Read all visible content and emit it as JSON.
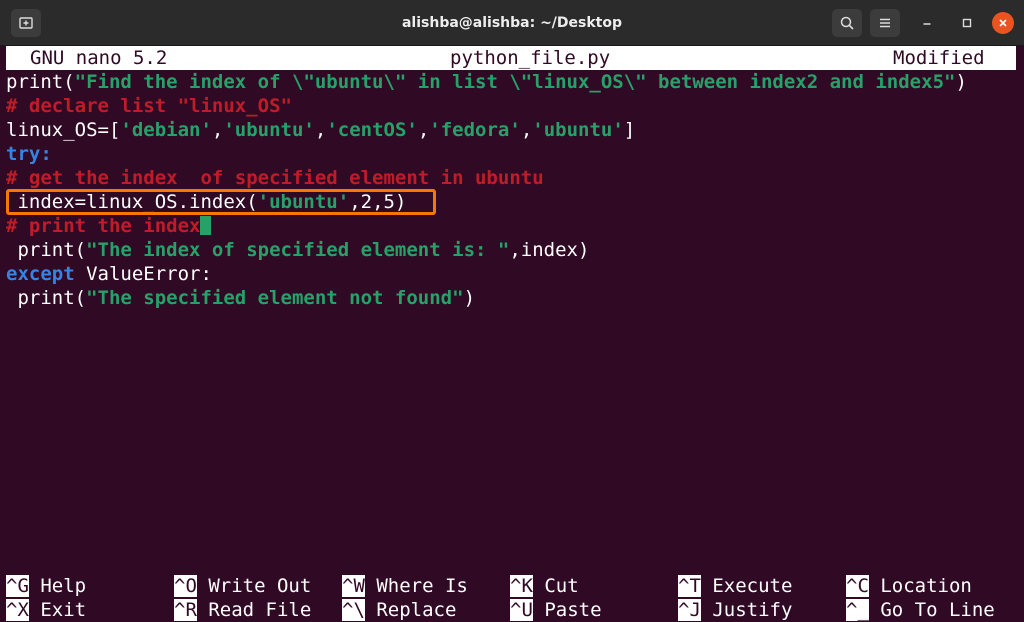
{
  "window": {
    "title": "alishba@alishba: ~/Desktop"
  },
  "nano": {
    "version": "GNU nano 5.2",
    "filename": "python_file.py",
    "status": "Modified"
  },
  "code": {
    "l1_a": "print(",
    "l1_b": "\"Find the index of \\\"ubuntu\\\" in list \\\"linux_OS\\\" between index2 and index5\"",
    "l1_c": ")",
    "l2": "# declare list \"linux_OS\"",
    "l3_a": "linux_OS=[",
    "l3_s1": "'debian'",
    "l3_c1": ",",
    "l3_s2": "'ubuntu'",
    "l3_c2": ",",
    "l3_s3": "'centOS'",
    "l3_c3": ",",
    "l3_s4": "'fedora'",
    "l3_c4": ",",
    "l3_s5": "'ubuntu'",
    "l3_b": "]",
    "l4": "try:",
    "l5": "# get the index  of specified element in ubuntu",
    "l6_a": " index=linux_OS.index(",
    "l6_s": "'ubuntu'",
    "l6_b": ",2,5)",
    "l7": "# print the index",
    "l8_a": " print(",
    "l8_s": "\"The index of specified element is: \"",
    "l8_b": ",index)",
    "l9_kw": "except",
    "l9_b": " ValueError:",
    "l10_a": " print(",
    "l10_s": "\"The specified element not found\"",
    "l10_b": ")"
  },
  "shortcuts": [
    {
      "key": "^G",
      "label": "Help"
    },
    {
      "key": "^O",
      "label": "Write Out"
    },
    {
      "key": "^W",
      "label": "Where Is"
    },
    {
      "key": "^K",
      "label": "Cut"
    },
    {
      "key": "^T",
      "label": "Execute"
    },
    {
      "key": "^C",
      "label": "Location"
    },
    {
      "key": "^X",
      "label": "Exit"
    },
    {
      "key": "^R",
      "label": "Read File"
    },
    {
      "key": "^\\",
      "label": "Replace"
    },
    {
      "key": "^U",
      "label": "Paste"
    },
    {
      "key": "^J",
      "label": "Justify"
    },
    {
      "key": "^_",
      "label": "Go To Line"
    }
  ],
  "icons": {
    "new_tab": "new-tab-icon",
    "search": "search-icon",
    "menu": "hamburger-menu-icon",
    "minimize": "minimize-icon",
    "maximize": "maximize-icon",
    "close": "close-icon"
  },
  "colors": {
    "terminal_bg": "#300a24",
    "string": "#26a269",
    "comment": "#c01c28",
    "keyword": "#3584e4",
    "highlight_box": "#f57900",
    "close_button": "#e95420"
  }
}
